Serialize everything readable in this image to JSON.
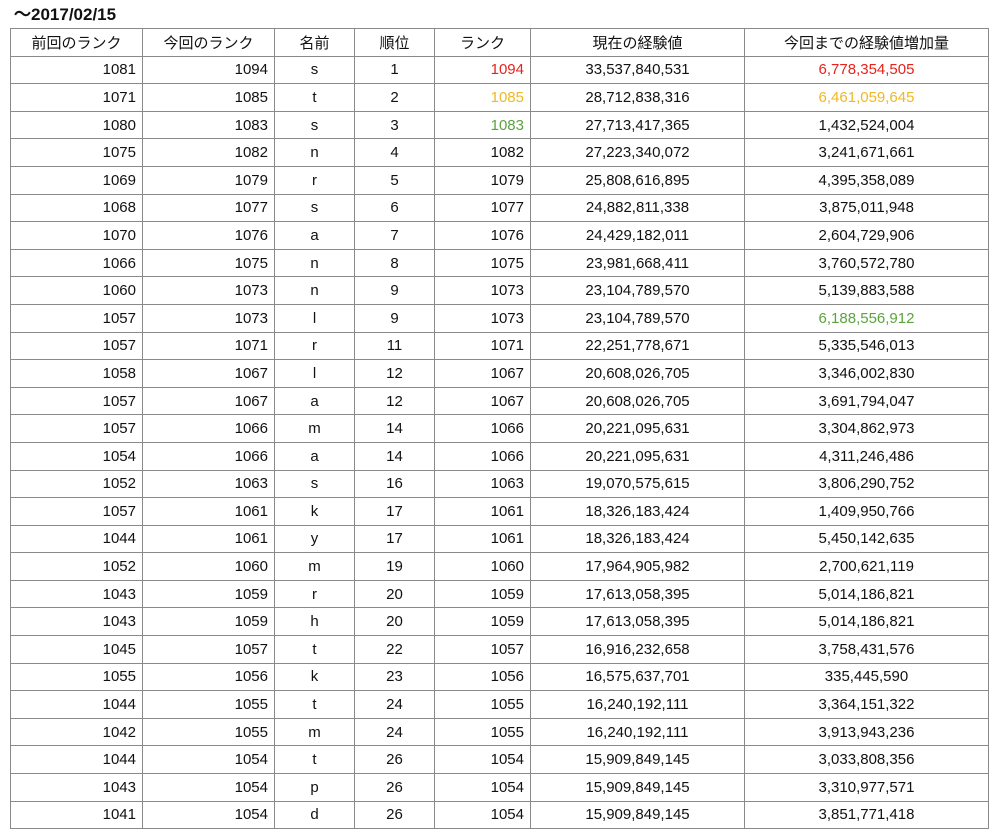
{
  "title": "〜2017/02/15",
  "headers": [
    "前回のランク",
    "今回のランク",
    "名前",
    "順位",
    "ランク",
    "現在の経験値",
    "今回までの経験値増加量"
  ],
  "colors": {
    "red": "#e8221b",
    "yellow": "#f0b824",
    "green": "#5aa33e"
  },
  "rows": [
    {
      "prev": "1081",
      "curr": "1094",
      "name": "s",
      "pos": "1",
      "rank": "1094",
      "exp": "33,537,840,531",
      "gain": "6,778,354,505",
      "rank_color": "red",
      "gain_color": "red"
    },
    {
      "prev": "1071",
      "curr": "1085",
      "name": "t",
      "pos": "2",
      "rank": "1085",
      "exp": "28,712,838,316",
      "gain": "6,461,059,645",
      "rank_color": "yellow",
      "gain_color": "yellow"
    },
    {
      "prev": "1080",
      "curr": "1083",
      "name": "s",
      "pos": "3",
      "rank": "1083",
      "exp": "27,713,417,365",
      "gain": "1,432,524,004",
      "rank_color": "green",
      "gain_color": ""
    },
    {
      "prev": "1075",
      "curr": "1082",
      "name": "n",
      "pos": "4",
      "rank": "1082",
      "exp": "27,223,340,072",
      "gain": "3,241,671,661",
      "rank_color": "",
      "gain_color": ""
    },
    {
      "prev": "1069",
      "curr": "1079",
      "name": "r",
      "pos": "5",
      "rank": "1079",
      "exp": "25,808,616,895",
      "gain": "4,395,358,089",
      "rank_color": "",
      "gain_color": ""
    },
    {
      "prev": "1068",
      "curr": "1077",
      "name": "s",
      "pos": "6",
      "rank": "1077",
      "exp": "24,882,811,338",
      "gain": "3,875,011,948",
      "rank_color": "",
      "gain_color": ""
    },
    {
      "prev": "1070",
      "curr": "1076",
      "name": "a",
      "pos": "7",
      "rank": "1076",
      "exp": "24,429,182,011",
      "gain": "2,604,729,906",
      "rank_color": "",
      "gain_color": ""
    },
    {
      "prev": "1066",
      "curr": "1075",
      "name": "n",
      "pos": "8",
      "rank": "1075",
      "exp": "23,981,668,411",
      "gain": "3,760,572,780",
      "rank_color": "",
      "gain_color": ""
    },
    {
      "prev": "1060",
      "curr": "1073",
      "name": "n",
      "pos": "9",
      "rank": "1073",
      "exp": "23,104,789,570",
      "gain": "5,139,883,588",
      "rank_color": "",
      "gain_color": ""
    },
    {
      "prev": "1057",
      "curr": "1073",
      "name": "l",
      "pos": "9",
      "rank": "1073",
      "exp": "23,104,789,570",
      "gain": "6,188,556,912",
      "rank_color": "",
      "gain_color": "green"
    },
    {
      "prev": "1057",
      "curr": "1071",
      "name": "r",
      "pos": "11",
      "rank": "1071",
      "exp": "22,251,778,671",
      "gain": "5,335,546,013",
      "rank_color": "",
      "gain_color": ""
    },
    {
      "prev": "1058",
      "curr": "1067",
      "name": "l",
      "pos": "12",
      "rank": "1067",
      "exp": "20,608,026,705",
      "gain": "3,346,002,830",
      "rank_color": "",
      "gain_color": ""
    },
    {
      "prev": "1057",
      "curr": "1067",
      "name": "a",
      "pos": "12",
      "rank": "1067",
      "exp": "20,608,026,705",
      "gain": "3,691,794,047",
      "rank_color": "",
      "gain_color": ""
    },
    {
      "prev": "1057",
      "curr": "1066",
      "name": "m",
      "pos": "14",
      "rank": "1066",
      "exp": "20,221,095,631",
      "gain": "3,304,862,973",
      "rank_color": "",
      "gain_color": ""
    },
    {
      "prev": "1054",
      "curr": "1066",
      "name": "a",
      "pos": "14",
      "rank": "1066",
      "exp": "20,221,095,631",
      "gain": "4,311,246,486",
      "rank_color": "",
      "gain_color": ""
    },
    {
      "prev": "1052",
      "curr": "1063",
      "name": "s",
      "pos": "16",
      "rank": "1063",
      "exp": "19,070,575,615",
      "gain": "3,806,290,752",
      "rank_color": "",
      "gain_color": ""
    },
    {
      "prev": "1057",
      "curr": "1061",
      "name": "k",
      "pos": "17",
      "rank": "1061",
      "exp": "18,326,183,424",
      "gain": "1,409,950,766",
      "rank_color": "",
      "gain_color": ""
    },
    {
      "prev": "1044",
      "curr": "1061",
      "name": "y",
      "pos": "17",
      "rank": "1061",
      "exp": "18,326,183,424",
      "gain": "5,450,142,635",
      "rank_color": "",
      "gain_color": ""
    },
    {
      "prev": "1052",
      "curr": "1060",
      "name": "m",
      "pos": "19",
      "rank": "1060",
      "exp": "17,964,905,982",
      "gain": "2,700,621,119",
      "rank_color": "",
      "gain_color": ""
    },
    {
      "prev": "1043",
      "curr": "1059",
      "name": "r",
      "pos": "20",
      "rank": "1059",
      "exp": "17,613,058,395",
      "gain": "5,014,186,821",
      "rank_color": "",
      "gain_color": ""
    },
    {
      "prev": "1043",
      "curr": "1059",
      "name": "h",
      "pos": "20",
      "rank": "1059",
      "exp": "17,613,058,395",
      "gain": "5,014,186,821",
      "rank_color": "",
      "gain_color": ""
    },
    {
      "prev": "1045",
      "curr": "1057",
      "name": "t",
      "pos": "22",
      "rank": "1057",
      "exp": "16,916,232,658",
      "gain": "3,758,431,576",
      "rank_color": "",
      "gain_color": ""
    },
    {
      "prev": "1055",
      "curr": "1056",
      "name": "k",
      "pos": "23",
      "rank": "1056",
      "exp": "16,575,637,701",
      "gain": "335,445,590",
      "rank_color": "",
      "gain_color": ""
    },
    {
      "prev": "1044",
      "curr": "1055",
      "name": "t",
      "pos": "24",
      "rank": "1055",
      "exp": "16,240,192,111",
      "gain": "3,364,151,322",
      "rank_color": "",
      "gain_color": ""
    },
    {
      "prev": "1042",
      "curr": "1055",
      "name": "m",
      "pos": "24",
      "rank": "1055",
      "exp": "16,240,192,111",
      "gain": "3,913,943,236",
      "rank_color": "",
      "gain_color": ""
    },
    {
      "prev": "1044",
      "curr": "1054",
      "name": "t",
      "pos": "26",
      "rank": "1054",
      "exp": "15,909,849,145",
      "gain": "3,033,808,356",
      "rank_color": "",
      "gain_color": ""
    },
    {
      "prev": "1043",
      "curr": "1054",
      "name": "p",
      "pos": "26",
      "rank": "1054",
      "exp": "15,909,849,145",
      "gain": "3,310,977,571",
      "rank_color": "",
      "gain_color": ""
    },
    {
      "prev": "1041",
      "curr": "1054",
      "name": "d",
      "pos": "26",
      "rank": "1054",
      "exp": "15,909,849,145",
      "gain": "3,851,771,418",
      "rank_color": "",
      "gain_color": ""
    }
  ]
}
